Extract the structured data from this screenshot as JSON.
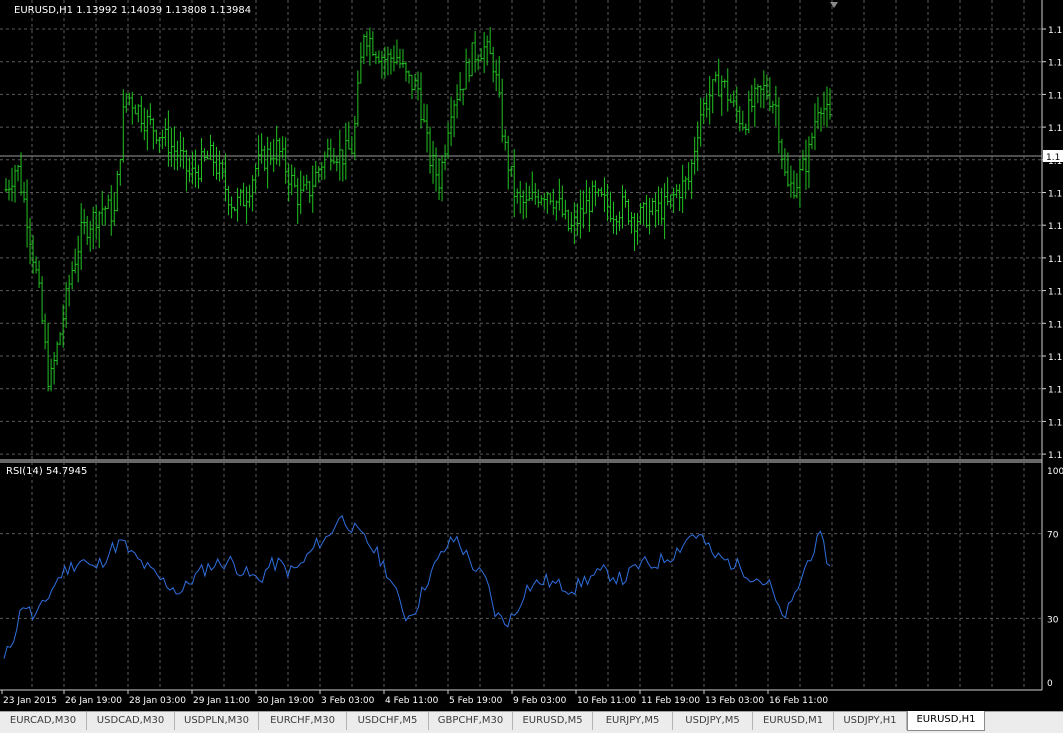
{
  "window": {
    "main_label": "EURUSD,H1  1.13992 1.14039 1.13808 1.13984",
    "indicator_label": "RSI(14) 54.7945"
  },
  "price_axis": {
    "labels": [
      "1.1",
      "1.1",
      "1.1",
      "1.1",
      "1.1",
      "1.1",
      "1.1",
      "1.1",
      "1.1",
      "1.1",
      "1.1",
      "1.1",
      "1.1",
      "1.1"
    ],
    "current_price_label": "1.1"
  },
  "rsi_axis": {
    "labels": [
      "100",
      "70",
      "30",
      "0"
    ]
  },
  "time_axis": {
    "labels": [
      "23 Jan 2015",
      "26 Jan 19:00",
      "28 Jan 03:00",
      "29 Jan 11:00",
      "30 Jan 19:00",
      "3 Feb 03:00",
      "4 Feb 11:00",
      "5 Feb 19:00",
      "9 Feb 03:00",
      "10 Feb 11:00",
      "11 Feb 19:00",
      "13 Feb 03:00",
      "16 Feb 11:00"
    ]
  },
  "tabs": [
    {
      "label": "EURCAD,M30",
      "active": false
    },
    {
      "label": "USDCAD,M30",
      "active": false
    },
    {
      "label": "USDPLN,M30",
      "active": false
    },
    {
      "label": "EURCHF,M30",
      "active": false
    },
    {
      "label": "USDCHF,M5",
      "active": false
    },
    {
      "label": "GBPCHF,M30",
      "active": false
    },
    {
      "label": "EURUSD,M5",
      "active": false
    },
    {
      "label": "EURJPY,M5",
      "active": false
    },
    {
      "label": "USDJPY,M5",
      "active": false
    },
    {
      "label": "EURUSD,M1",
      "active": false
    },
    {
      "label": "USDJPY,H1",
      "active": false
    },
    {
      "label": "EURUSD,H1",
      "active": true
    }
  ],
  "colors": {
    "background": "#000000",
    "grid": "#5a5a5a",
    "bars": "#22c322",
    "rsi_line": "#2f6fdf",
    "axis_text": "#ffffff",
    "tab_bar": "#ececec"
  },
  "chart_data": [
    {
      "type": "ohlc-bar",
      "symbol": "EURUSD",
      "timeframe": "H1",
      "title": "EURUSD,H1  1.13992 1.14039 1.13808 1.13984",
      "last_bar": {
        "open": 1.13992,
        "high": 1.14039,
        "low": 1.13808,
        "close": 1.13984
      },
      "series_shape_close": [
        0.62,
        0.68,
        0.55,
        0.38,
        0.15,
        0.28,
        0.42,
        0.52,
        0.55,
        0.58,
        0.56,
        0.85,
        0.82,
        0.78,
        0.76,
        0.73,
        0.7,
        0.65,
        0.68,
        0.7,
        0.64,
        0.58,
        0.6,
        0.67,
        0.7,
        0.72,
        0.66,
        0.6,
        0.62,
        0.68,
        0.72,
        0.7,
        0.72,
        1.0,
        0.96,
        0.93,
        0.94,
        0.88,
        0.86,
        0.7,
        0.64,
        0.82,
        0.87,
        0.94,
        0.96,
        0.92,
        0.72,
        0.6,
        0.58,
        0.61,
        0.62,
        0.58,
        0.52,
        0.56,
        0.6,
        0.59,
        0.57,
        0.58,
        0.55,
        0.56,
        0.57,
        0.58,
        0.62,
        0.64,
        0.8,
        0.85,
        0.88,
        0.82,
        0.78,
        0.83,
        0.86,
        0.82,
        0.62,
        0.64,
        0.7,
        0.84,
        0.78
      ],
      "series_count": "a few hundred hourly bars"
    },
    {
      "type": "line",
      "title": "RSI(14) 54.7945",
      "ylim": [
        0,
        100
      ],
      "levels": [
        30,
        70
      ],
      "last_value": 54.7945,
      "y": [
        10,
        22,
        38,
        30,
        36,
        45,
        52,
        55,
        58,
        53,
        57,
        63,
        66,
        60,
        56,
        52,
        48,
        45,
        42,
        48,
        52,
        55,
        56,
        57,
        53,
        50,
        48,
        55,
        56,
        52,
        54,
        60,
        66,
        68,
        78,
        75,
        70,
        66,
        60,
        52,
        40,
        30,
        36,
        48,
        56,
        64,
        68,
        60,
        53,
        48,
        32,
        28,
        32,
        44,
        46,
        48,
        46,
        45,
        44,
        48,
        50,
        52,
        50,
        48,
        53,
        56,
        55,
        58,
        60,
        65,
        70,
        68,
        60,
        58,
        56,
        54,
        50,
        48,
        45,
        30,
        35,
        48,
        60,
        68,
        54.7945
      ]
    }
  ]
}
